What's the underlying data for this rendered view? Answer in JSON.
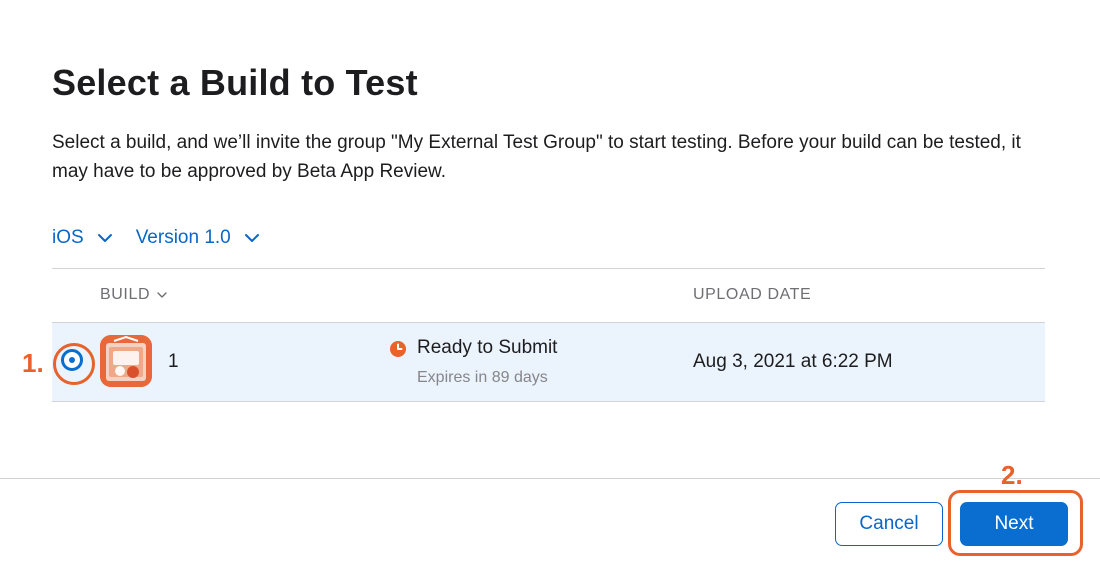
{
  "dialog": {
    "title": "Select a Build to Test",
    "description": "Select a build, and we’ll invite the group \"My External Test Group\" to start testing. Before your build can be tested, it may have to be approved by Beta App Review."
  },
  "filters": {
    "platform": "iOS",
    "version": "Version 1.0"
  },
  "table": {
    "columns": {
      "build": "BUILD",
      "upload_date": "UPLOAD DATE"
    },
    "rows": [
      {
        "selected": true,
        "build_number": "1",
        "status": "Ready to Submit",
        "status_detail": "Expires in 89 days",
        "upload_date": "Aug 3, 2021 at 6:22 PM"
      }
    ]
  },
  "buttons": {
    "cancel": "Cancel",
    "next": "Next"
  },
  "annotations": {
    "step_1": "1.",
    "step_2": "2."
  },
  "icons": {
    "platform_dropdown": "chevron-down-icon",
    "version_dropdown": "chevron-down-icon",
    "build_sort": "chevron-down-icon",
    "status": "clock-icon",
    "app": "app-icon"
  },
  "colors": {
    "accent": "#0a6ed1",
    "link": "#0a66c8",
    "selected_row": "#ebf3fc",
    "status_orange": "#e8622c",
    "annotation": "#e8622c"
  }
}
